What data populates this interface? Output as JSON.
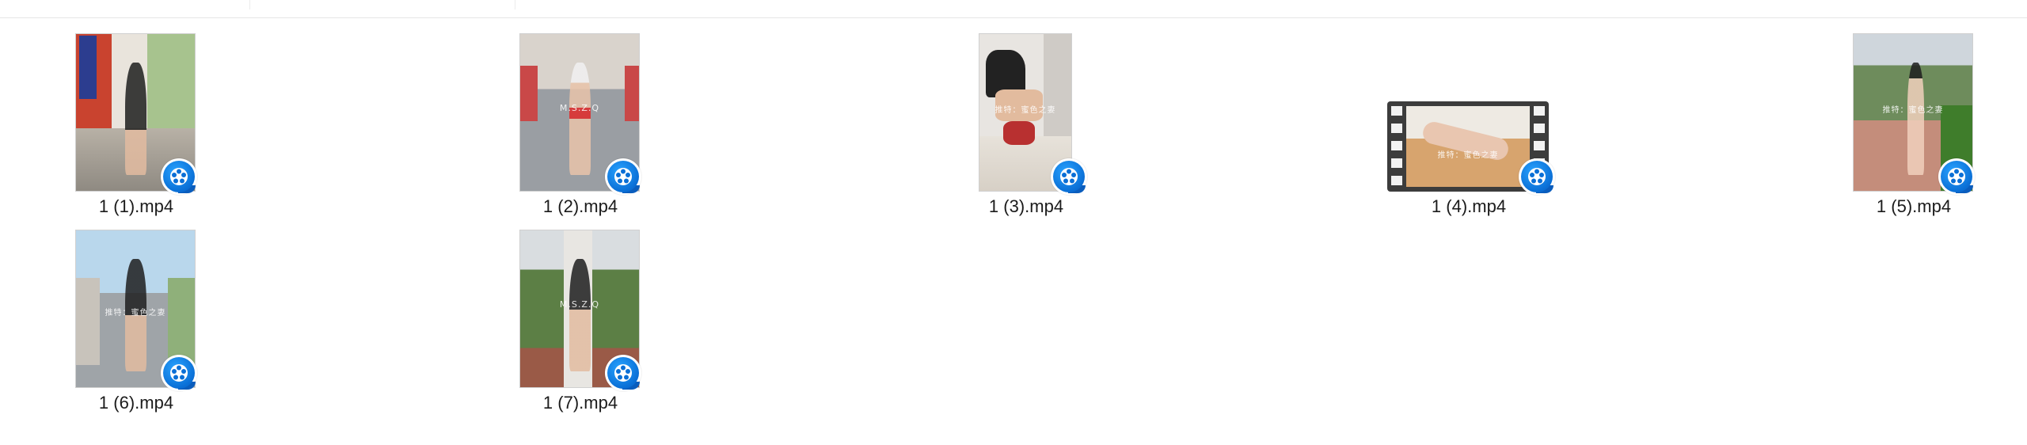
{
  "files": [
    {
      "name": "1 (1).mp4",
      "icon": "video-player-badge-icon"
    },
    {
      "name": "1 (2).mp4",
      "icon": "video-player-badge-icon",
      "watermark": "M.S.Z.Q"
    },
    {
      "name": "1 (3).mp4",
      "icon": "video-player-badge-icon",
      "watermark": "推特：蜜色之妻"
    },
    {
      "name": "1 (4).mp4",
      "icon": "video-player-badge-icon",
      "watermark": "推特：蜜色之妻"
    },
    {
      "name": "1 (5).mp4",
      "icon": "video-player-badge-icon",
      "watermark": "推特：蜜色之妻"
    },
    {
      "name": "1 (6).mp4",
      "icon": "video-player-badge-icon",
      "watermark": "推特：蜜色之妻"
    },
    {
      "name": "1 (7).mp4",
      "icon": "video-player-badge-icon",
      "watermark": "M.S.Z.Q"
    }
  ],
  "colors": {
    "badge_blue": "#0a6fd6",
    "label_text": "#1b1b1b"
  }
}
